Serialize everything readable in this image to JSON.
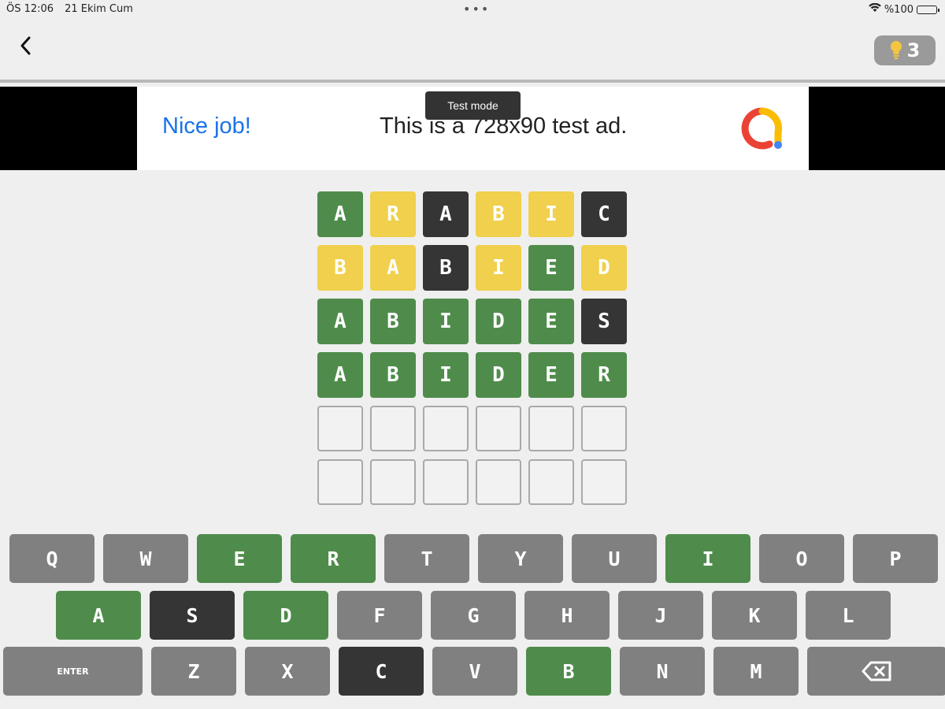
{
  "status_bar": {
    "time": "ÖS 12:06",
    "date": "21 Ekim Cum",
    "dots": "•••",
    "battery": "%100",
    "battery_level": 1.0
  },
  "header": {
    "hint_count": "3"
  },
  "ad": {
    "headline": "Nice job!",
    "body": "This is a 728x90 test ad.",
    "badge": "Test mode"
  },
  "colors": {
    "correct": "#4f8c4b",
    "present": "#f0d04c",
    "absent": "#353535",
    "unused_key": "#808080"
  },
  "board": {
    "rows": [
      [
        {
          "l": "A",
          "s": "correct"
        },
        {
          "l": "R",
          "s": "present"
        },
        {
          "l": "A",
          "s": "absent"
        },
        {
          "l": "B",
          "s": "present"
        },
        {
          "l": "I",
          "s": "present"
        },
        {
          "l": "C",
          "s": "absent"
        }
      ],
      [
        {
          "l": "B",
          "s": "present"
        },
        {
          "l": "A",
          "s": "present"
        },
        {
          "l": "B",
          "s": "absent"
        },
        {
          "l": "I",
          "s": "present"
        },
        {
          "l": "E",
          "s": "correct"
        },
        {
          "l": "D",
          "s": "present"
        }
      ],
      [
        {
          "l": "A",
          "s": "correct"
        },
        {
          "l": "B",
          "s": "correct"
        },
        {
          "l": "I",
          "s": "correct"
        },
        {
          "l": "D",
          "s": "correct"
        },
        {
          "l": "E",
          "s": "correct"
        },
        {
          "l": "S",
          "s": "absent"
        }
      ],
      [
        {
          "l": "A",
          "s": "correct"
        },
        {
          "l": "B",
          "s": "correct"
        },
        {
          "l": "I",
          "s": "correct"
        },
        {
          "l": "D",
          "s": "correct"
        },
        {
          "l": "E",
          "s": "correct"
        },
        {
          "l": "R",
          "s": "correct"
        }
      ],
      [
        {
          "l": "",
          "s": "empty"
        },
        {
          "l": "",
          "s": "empty"
        },
        {
          "l": "",
          "s": "empty"
        },
        {
          "l": "",
          "s": "empty"
        },
        {
          "l": "",
          "s": "empty"
        },
        {
          "l": "",
          "s": "empty"
        }
      ],
      [
        {
          "l": "",
          "s": "empty"
        },
        {
          "l": "",
          "s": "empty"
        },
        {
          "l": "",
          "s": "empty"
        },
        {
          "l": "",
          "s": "empty"
        },
        {
          "l": "",
          "s": "empty"
        },
        {
          "l": "",
          "s": "empty"
        }
      ]
    ]
  },
  "keyboard": {
    "rows": [
      [
        {
          "k": "Q",
          "s": "unused"
        },
        {
          "k": "W",
          "s": "unused"
        },
        {
          "k": "E",
          "s": "correct"
        },
        {
          "k": "R",
          "s": "correct"
        },
        {
          "k": "T",
          "s": "unused"
        },
        {
          "k": "Y",
          "s": "unused"
        },
        {
          "k": "U",
          "s": "unused"
        },
        {
          "k": "I",
          "s": "correct"
        },
        {
          "k": "O",
          "s": "unused"
        },
        {
          "k": "P",
          "s": "unused"
        }
      ],
      [
        {
          "k": "A",
          "s": "correct"
        },
        {
          "k": "S",
          "s": "absent"
        },
        {
          "k": "D",
          "s": "correct"
        },
        {
          "k": "F",
          "s": "unused"
        },
        {
          "k": "G",
          "s": "unused"
        },
        {
          "k": "H",
          "s": "unused"
        },
        {
          "k": "J",
          "s": "unused"
        },
        {
          "k": "K",
          "s": "unused"
        },
        {
          "k": "L",
          "s": "unused"
        }
      ],
      [
        {
          "k": "ENTER",
          "s": "enter"
        },
        {
          "k": "Z",
          "s": "unused"
        },
        {
          "k": "X",
          "s": "unused"
        },
        {
          "k": "C",
          "s": "absent"
        },
        {
          "k": "V",
          "s": "unused"
        },
        {
          "k": "B",
          "s": "correct"
        },
        {
          "k": "N",
          "s": "unused"
        },
        {
          "k": "M",
          "s": "unused"
        },
        {
          "k": "",
          "s": "backspace",
          "icon": "backspace-icon"
        }
      ]
    ]
  }
}
